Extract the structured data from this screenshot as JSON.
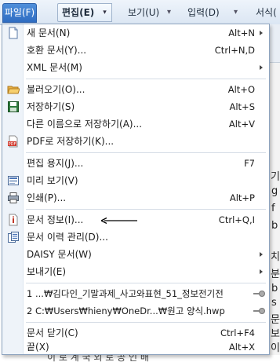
{
  "menubar": {
    "file": "파일(F)",
    "edit": "편집(E)",
    "view": "보기(U)",
    "insert": "입력(D)",
    "format": "서식("
  },
  "background": {
    "right_chars": [
      "기",
      "g",
      "f",
      "b",
      "치",
      "분",
      "b",
      "s",
      "문",
      "보",
      "이"
    ],
    "bottom_text": "이 로 계   국 외 로 공 인 배"
  },
  "menu": {
    "items": [
      {
        "label": "새 문서(N)",
        "shortcut": "Alt+N",
        "icon": "new-document-icon",
        "submenu": true
      },
      {
        "label": "호환 문서(Y)...",
        "shortcut": "Ctrl+N,D",
        "icon": "",
        "submenu": false
      },
      {
        "label": "XML 문서(M)",
        "shortcut": "",
        "icon": "",
        "submenu": true
      },
      {
        "label": "불러오기(O)...",
        "shortcut": "Alt+O",
        "icon": "open-folder-icon",
        "submenu": false
      },
      {
        "label": "저장하기(S)",
        "shortcut": "Alt+S",
        "icon": "save-disk-icon",
        "submenu": false
      },
      {
        "label": "다른 이름으로 저장하기(A)...",
        "shortcut": "Alt+V",
        "icon": "",
        "submenu": false
      },
      {
        "label": "PDF로 저장하기(K)...",
        "shortcut": "",
        "icon": "pdf-icon",
        "submenu": false
      },
      {
        "label": "편집 용지(J)...",
        "shortcut": "F7",
        "icon": "",
        "submenu": false
      },
      {
        "label": "미리 보기(V)",
        "shortcut": "",
        "icon": "print-preview-icon",
        "submenu": false
      },
      {
        "label": "인쇄(P)...",
        "shortcut": "Alt+P",
        "icon": "printer-icon",
        "submenu": false
      },
      {
        "label": "문서 정보(I)...",
        "shortcut": "Ctrl+Q,I",
        "icon": "document-info-icon",
        "submenu": false
      },
      {
        "label": "문서 이력 관리(D)...",
        "shortcut": "",
        "icon": "document-history-icon",
        "submenu": false
      },
      {
        "label": "DAISY 문서(W)",
        "shortcut": "",
        "icon": "",
        "submenu": true
      },
      {
        "label": "보내기(E)",
        "shortcut": "",
        "icon": "",
        "submenu": true
      },
      {
        "label": "1 ...₩김다인_기말과제_사고와표현_51_정보전기전",
        "shortcut": "",
        "icon": "",
        "submenu": false,
        "pin": true
      },
      {
        "label": "2 C:₩Users₩hieny₩OneDr...₩원고 양식.hwp",
        "shortcut": "",
        "icon": "",
        "submenu": false,
        "pin": true
      },
      {
        "label": "문서 닫기(C)",
        "shortcut": "Ctrl+F4",
        "icon": "",
        "submenu": false
      },
      {
        "label": "끝(X)",
        "shortcut": "Alt+X",
        "icon": "",
        "submenu": false
      }
    ]
  },
  "colors": {
    "file_tab": "#2e6cc2",
    "gutter": "#eef3f9",
    "menu_border": "#8ea4bf"
  }
}
